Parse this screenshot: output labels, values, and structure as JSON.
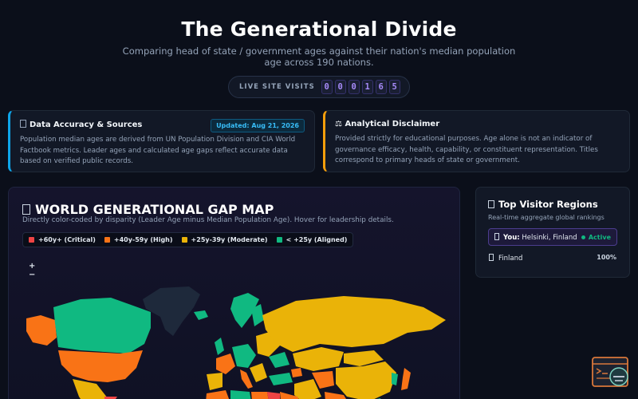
{
  "header": {
    "title": "The Generational Divide",
    "subtitle": "Comparing head of state / government ages against their nation's median population age across 190 nations."
  },
  "visits": {
    "label": "LIVE SITE VISITS",
    "digits": [
      "0",
      "0",
      "0",
      "1",
      "6",
      "5"
    ]
  },
  "sources_card": {
    "icon": "info-icon",
    "title": "Data Accuracy & Sources",
    "badge": "Updated: Aug 21, 2026",
    "body": "Population median ages are derived from UN Population Division and CIA World Factbook metrics. Leader ages and calculated age gaps reflect accurate data based on verified public records."
  },
  "disclaimer_card": {
    "icon": "scale-icon",
    "title": "⚖ Analytical Disclaimer",
    "body": "Provided strictly for educational purposes. Age alone is not an indicator of governance efficacy, health, capability, or constituent representation. Titles correspond to primary heads of state or government."
  },
  "map": {
    "icon": "globe-icon",
    "title": "WORLD GENERATIONAL GAP MAP",
    "subtitle": "Directly color-coded by disparity (Leader Age minus Median Population Age). Hover for leadership details.",
    "zoom_in": "+",
    "zoom_out": "−",
    "legend": [
      {
        "label": "+60y+ (Critical)",
        "color": "#ef4444"
      },
      {
        "label": "+40y-59y (High)",
        "color": "#f97316"
      },
      {
        "label": "+25y-39y (Moderate)",
        "color": "#eab308"
      },
      {
        "label": "< +25y (Aligned)",
        "color": "#10b981"
      }
    ]
  },
  "visitors": {
    "icon": "chart-icon",
    "title": "Top Visitor Regions",
    "subtitle": "Real-time aggregate global rankings",
    "you": {
      "icon": "pin-icon",
      "label": "You:",
      "location": "Helsinki, Finland",
      "status": "Active"
    },
    "regions": [
      {
        "icon": "flag-icon",
        "name": "Finland",
        "percent": "100%"
      }
    ]
  },
  "colors": {
    "accent": "#a78bfa",
    "info": "#0ea5e9",
    "warning": "#f59e0b",
    "active": "#10b981",
    "no_data": "#1e293b"
  },
  "fab": {
    "icon": "terminal-icon"
  }
}
